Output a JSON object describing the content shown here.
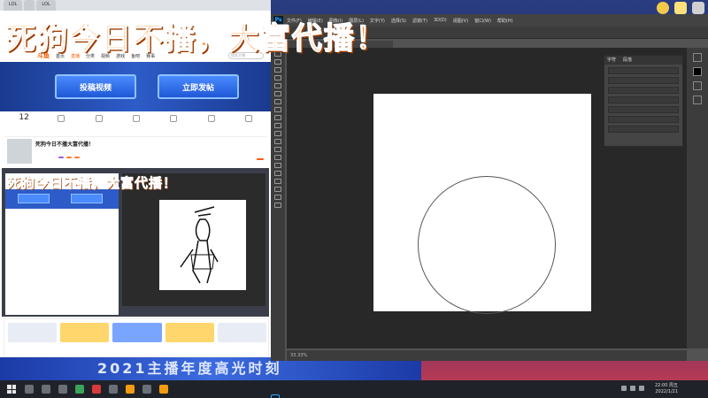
{
  "banner": {
    "main": "死狗今日不播，大富代播！",
    "small": "死狗今日不播，大富代播！"
  },
  "browser": {
    "tabs": [
      "LOL",
      "",
      "LOL"
    ],
    "nav": {
      "logo": "斗鱼",
      "items": [
        "首页",
        "直播",
        "分类",
        "视频",
        "游戏",
        "鱼吧",
        "赛事"
      ],
      "active_index": 1,
      "search_placeholder": "搜索主播"
    },
    "hero": {
      "upload_video": "投稿视频",
      "post_now": "立即发帖"
    },
    "stats": [
      {
        "value": "12",
        "label": ""
      },
      {
        "value": "",
        "label": ""
      },
      {
        "value": "",
        "label": ""
      },
      {
        "value": "",
        "label": ""
      },
      {
        "value": "",
        "label": ""
      },
      {
        "value": "",
        "label": ""
      },
      {
        "value": "",
        "label": ""
      }
    ],
    "profile": {
      "title": "死狗今日不播大富代播！",
      "meta": "",
      "badges": [
        "",
        "",
        ""
      ],
      "follow": ""
    },
    "bottom_band": "2021主播年度高光时刻"
  },
  "photoshop": {
    "logo": "Ps",
    "menu": [
      "文件(F)",
      "编辑(E)",
      "图像(I)",
      "图层(L)",
      "文字(Y)",
      "选择(S)",
      "滤镜(T)",
      "3D(D)",
      "视图(V)",
      "窗口(W)",
      "帮助(H)"
    ],
    "doc_tab": "",
    "status": "33.33%",
    "panel_tabs": [
      "字符",
      "段落"
    ]
  },
  "taskbar": {
    "time": "22:00 周五",
    "date": "2022/1/21"
  }
}
